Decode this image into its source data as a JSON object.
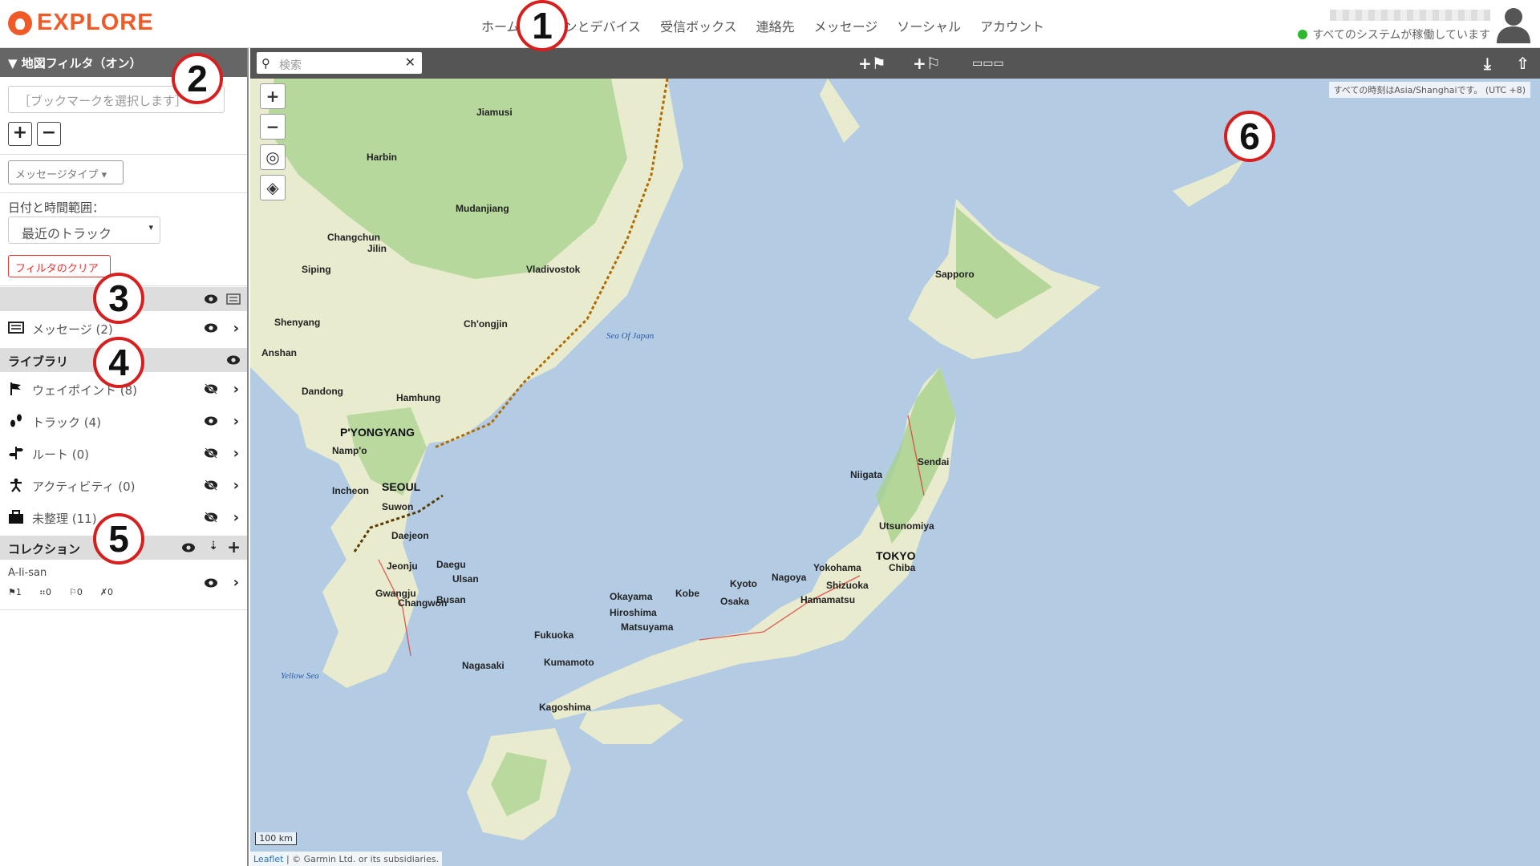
{
  "header": {
    "logo_text": "EXPLORE",
    "nav": [
      "ホーム",
      "プランとデバイス",
      "受信ボックス",
      "連絡先",
      "メッセージ",
      "ソーシャル",
      "アカウント"
    ],
    "status_text": "すべてのシステムが稼働しています",
    "status_color": "#2eb82e"
  },
  "sidebar": {
    "filter_title": "▼ 地図フィルタ（オン）",
    "bookmark_placeholder": "［ブックマークを選択します］",
    "zoom_in": "+",
    "zoom_out": "−",
    "message_type": "メッセージタイプ ▾",
    "date_label": "日付と時間範囲：",
    "date_value": "最近のトラック",
    "clear_filter": "フィルタのクリア",
    "feed_title": "",
    "messages_label": "メッセージ (2)",
    "library_title": "ライブラリ",
    "library_items": [
      {
        "label": "ウェイポイント (8)",
        "icon": "flag-icon"
      },
      {
        "label": "トラック (4)",
        "icon": "footsteps-icon"
      },
      {
        "label": "ルート (0)",
        "icon": "route-icon"
      },
      {
        "label": "アクティビティ (0)",
        "icon": "activity-icon"
      },
      {
        "label": "未整理 (11)",
        "icon": "briefcase-icon"
      }
    ],
    "collections_title": "コレクション",
    "collection_name": "A-li-san",
    "collection_counts": [
      "1",
      "0",
      "0",
      "0"
    ]
  },
  "map": {
    "search_placeholder": "検索",
    "timezone_note": "すべての時刻はAsia/Shanghaiです。 (UTC +8)",
    "scale_label": "100 km",
    "attribution_link": "Leaflet",
    "attribution_text": " | © Garmin Ltd. or its subsidiaries.",
    "sea_labels": [
      "Sea Of Japan",
      "Yellow Sea"
    ],
    "cities": [
      "Jiamusi",
      "Harbin",
      "Mudanjiang",
      "Changchun",
      "Jilin",
      "Siping",
      "Vladivostok",
      "Shenyang",
      "Anshan",
      "Ch'ongjin",
      "Dandong",
      "Hamhung",
      "P'YONGYANG",
      "Namp'o",
      "Incheon",
      "SEOUL",
      "Suwon",
      "Daejeon",
      "Jeonju",
      "Daegu",
      "Ulsan",
      "Gwangju",
      "Busan",
      "Changwon",
      "Sapporo",
      "Sendai",
      "Niigata",
      "Utsunomiya",
      "TOKYO",
      "Chiba",
      "Yokohama",
      "Nagoya",
      "Shizuoka",
      "Hamamatsu",
      "Kyoto",
      "Kobe",
      "Osaka",
      "Okayama",
      "Hiroshima",
      "Matsuyama",
      "Fukuoka",
      "Nagasaki",
      "Kumamoto",
      "Kagoshima"
    ]
  },
  "badges": [
    "1",
    "2",
    "3",
    "4",
    "5",
    "6"
  ],
  "colors": {
    "accent": "#f05a28",
    "toolbar": "#555555",
    "sea": "#b3cce4",
    "land": "#e8ebcd",
    "forest": "#a6d18c",
    "badge_border": "#d62020"
  }
}
